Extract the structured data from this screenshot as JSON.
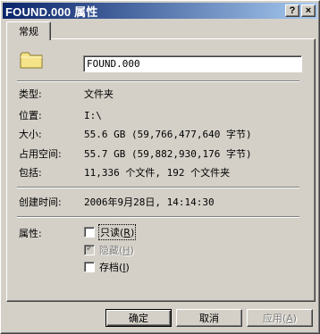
{
  "window": {
    "title": "FOUND.000 属性",
    "help_label": "?",
    "close_label": "×"
  },
  "tabs": [
    {
      "label": "常规",
      "active": true
    }
  ],
  "general": {
    "folder_icon": "folder-icon",
    "name_value": "FOUND.000",
    "properties": [
      {
        "label": "类型:",
        "value": "文件夹"
      },
      {
        "label": "位置:",
        "value": "I:\\"
      },
      {
        "label": "大小:",
        "value": "55.6 GB (59,766,477,640 字节)"
      },
      {
        "label": "占用空间:",
        "value": "55.7 GB (59,882,930,176 字节)"
      },
      {
        "label": "包括:",
        "value": "11,336 个文件, 192 个文件夹"
      }
    ],
    "created": {
      "label": "创建时间:",
      "value": "2006年9月28日, 14:14:30"
    },
    "attributes": {
      "label": "属性:",
      "items": [
        {
          "text": "只读",
          "key": "R",
          "checked": false,
          "disabled": false,
          "focused": true
        },
        {
          "text": "隐藏",
          "key": "H",
          "checked": true,
          "disabled": true,
          "focused": false
        },
        {
          "text": "存档",
          "key": "I",
          "checked": false,
          "disabled": false,
          "focused": false
        }
      ]
    }
  },
  "buttons": {
    "ok": "确定",
    "cancel": "取消",
    "apply_text": "应用",
    "apply_key": "A"
  },
  "colors": {
    "title_start": "#0a246a",
    "title_end": "#a6caf0",
    "face": "#d4d0c8",
    "folder": "#f5e38a"
  }
}
